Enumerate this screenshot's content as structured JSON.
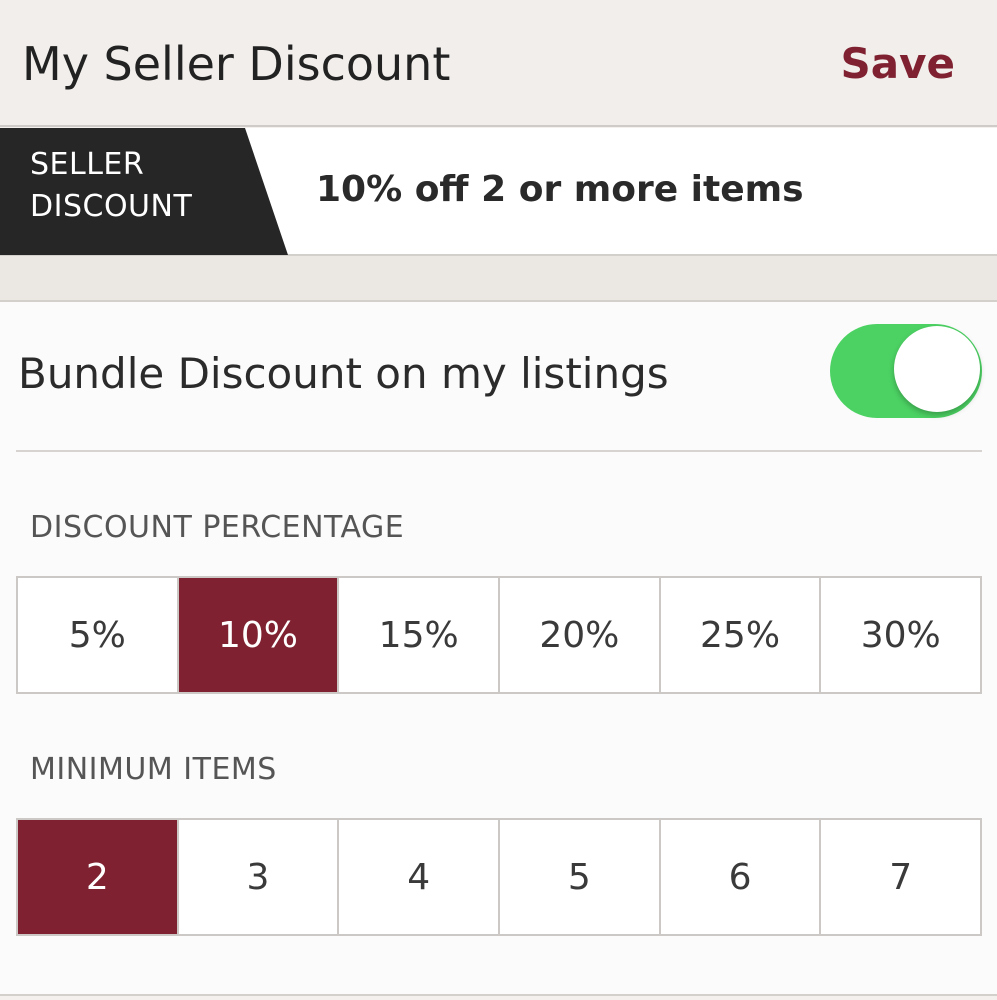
{
  "header": {
    "title": "My Seller Discount",
    "save_label": "Save"
  },
  "banner": {
    "tag_label": "SELLER DISCOUNT",
    "summary": "10% off 2 or more items"
  },
  "bundle": {
    "label": "Bundle Discount on my listings",
    "enabled": true
  },
  "discount_percentage": {
    "label": "DISCOUNT PERCENTAGE",
    "options": [
      "5%",
      "10%",
      "15%",
      "20%",
      "25%",
      "30%"
    ],
    "selected": "10%"
  },
  "minimum_items": {
    "label": "MINIMUM ITEMS",
    "options": [
      "2",
      "3",
      "4",
      "5",
      "6",
      "7"
    ],
    "selected": "2"
  },
  "colors": {
    "accent": "#7f2130",
    "toggle_on": "#4cd263",
    "tag_background": "#262626"
  }
}
